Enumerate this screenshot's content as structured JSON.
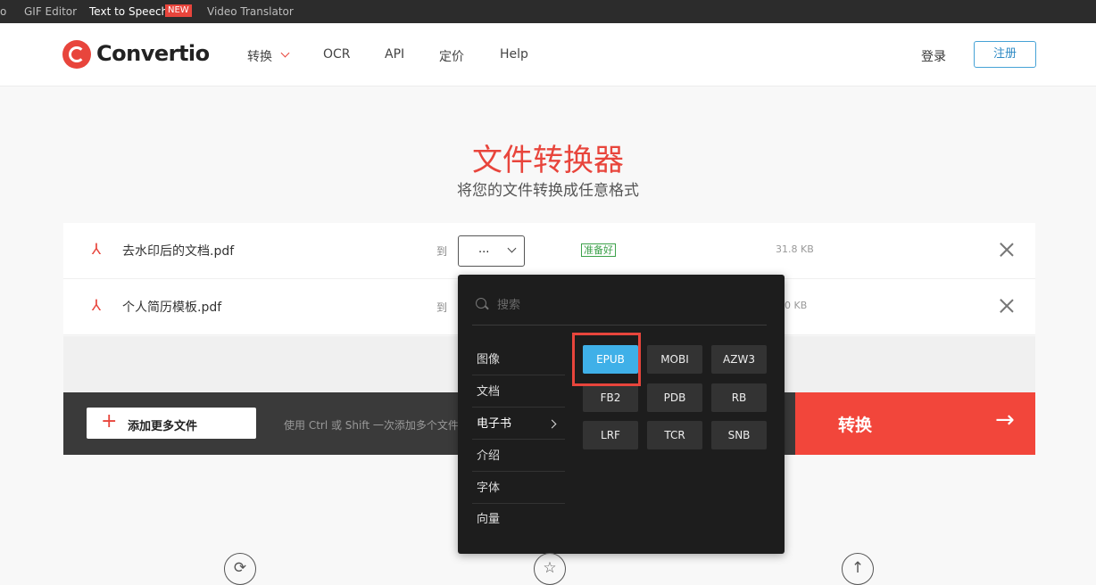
{
  "topbar": {
    "item0": "o",
    "item1": "GIF Editor",
    "item2": "Text to Speech",
    "badge": "NEW",
    "item3": "Video Translator"
  },
  "header": {
    "logo": "Convertio",
    "nav": [
      "转换",
      "OCR",
      "API",
      "定价",
      "Help"
    ],
    "login": "登录",
    "register": "注册"
  },
  "hero": {
    "title": "文件转换器",
    "subtitle": "将您的文件转换成任意格式"
  },
  "files": [
    {
      "name": "去水印后的文档.pdf",
      "to": "到",
      "format": "...",
      "status": "准备好",
      "size": "31.8 KB"
    },
    {
      "name": "个人简历模板.pdf",
      "to": "到",
      "size": "00 KB"
    }
  ],
  "actions": {
    "add_more": "添加更多文件",
    "hint": "使用 Ctrl 或 Shift 一次添加多个文件",
    "convert": "转换",
    "convert_arrow": "→"
  },
  "dropdown": {
    "search_placeholder": "搜索",
    "categories": [
      "图像",
      "文档",
      "电子书",
      "介绍",
      "字体",
      "向量"
    ],
    "active_category": "电子书",
    "formats": [
      "EPUB",
      "MOBI",
      "AZW3",
      "FB2",
      "PDB",
      "RB",
      "LRF",
      "TCR",
      "SNB"
    ],
    "selected_format": "EPUB"
  },
  "features": {
    "icon1": "⟳",
    "icon2": "☆",
    "icon3": "↑"
  },
  "colors": {
    "brand": "#e8453c",
    "selected_format": "#3fb0e8",
    "ready": "#3ca14a"
  }
}
